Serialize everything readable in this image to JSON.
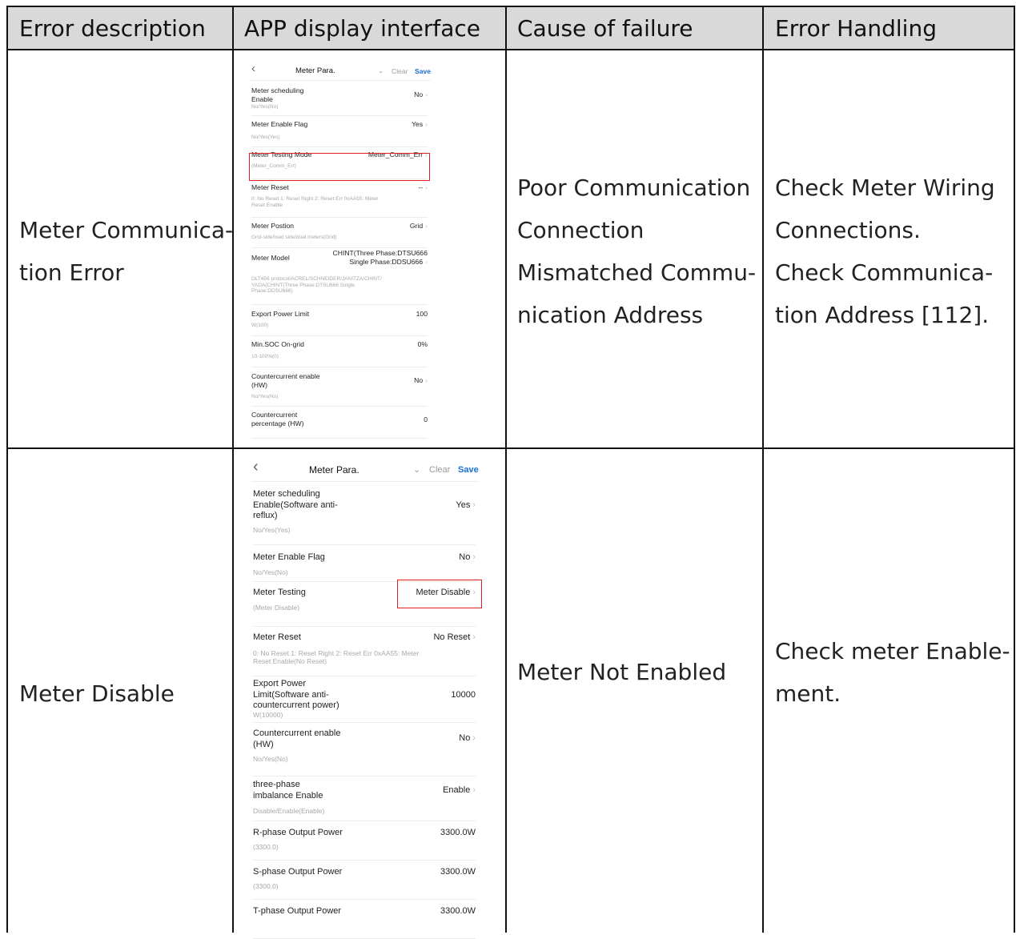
{
  "headers": [
    "Error description",
    "APP display interface",
    "Cause of failure",
    "Error Handling"
  ],
  "rows": [
    {
      "description": [
        "Meter Communica-",
        "tion Error"
      ],
      "cause": [
        "Poor Communication",
        "Connection",
        "Mismatched Commu-",
        "nication Address"
      ],
      "handling": [
        "Check Meter Wiring",
        "Connections.",
        "Check Communica-",
        "tion Address [112]."
      ]
    },
    {
      "description": [
        "Meter Disable"
      ],
      "cause": [
        "Meter Not Enabled"
      ],
      "handling": [
        "Check meter Enable-",
        "ment."
      ]
    }
  ],
  "app1": {
    "title": "Meter Para.",
    "clear": "Clear",
    "save": "Save",
    "items": [
      {
        "label": [
          "Meter scheduling",
          "Enable"
        ],
        "value": "No",
        "hint": [
          "No/Yes(No)"
        ]
      },
      {
        "label": [
          "Meter Enable Flag"
        ],
        "value": "Yes",
        "hint": [
          "No/Yes(Yes)"
        ]
      },
      {
        "label": [
          "Meter Testing Mode"
        ],
        "value": "Meter_Comm_Err",
        "hint": [
          "(Meter_Comm_Err)"
        ]
      },
      {
        "label": [
          "Meter Reset"
        ],
        "value": "--",
        "hint": [
          "0:  No Reset 1:  Reset Right  2:  Reset Err  0xAA55:  Meter",
          "Reset Enable"
        ]
      },
      {
        "label": [
          "Meter Postion"
        ],
        "value": "Grid",
        "hint": [
          "Grid-side/load side/dual meters(Grid)"
        ]
      },
      {
        "label": [
          "Meter Model"
        ],
        "value": "CHINT(Three Phase:DTSU666 Single Phase:DDSU666",
        "hint": [
          "DLT456 protocol/ACREL/SCHNEIDER/JANITZA/CHINT/",
          "YADA(CHINT(Three Phase:DTSU666 Single",
          "Phase:DDSU666)"
        ]
      },
      {
        "label": [
          "Export Power Limit"
        ],
        "value": "100",
        "hint": [
          "W(100)"
        ]
      },
      {
        "label": [
          "Min.SOC On-grid"
        ],
        "value": "0%",
        "hint": [
          "10-100%(0)"
        ]
      },
      {
        "label": [
          "Countercurrent enable",
          "(HW)"
        ],
        "value": "No",
        "hint": [
          "No/Yes(No)"
        ]
      },
      {
        "label": [
          "Countercurrent",
          "percentage (HW)"
        ],
        "value": "0",
        "hint": []
      }
    ]
  },
  "app2": {
    "title": "Meter Para.",
    "clear": "Clear",
    "save": "Save",
    "items": [
      {
        "label": [
          "Meter scheduling",
          "Enable(Software anti-",
          "reflux)"
        ],
        "value": "Yes",
        "hint": [
          "No/Yes(Yes)"
        ]
      },
      {
        "label": [
          "Meter Enable Flag"
        ],
        "value": "No",
        "hint": [
          "No/Yes(No)"
        ]
      },
      {
        "label": [
          "Meter Testing"
        ],
        "value": "Meter Disable",
        "hint": [
          "(Meter Disable)"
        ]
      },
      {
        "label": [
          "Meter Reset"
        ],
        "value": "No Reset",
        "hint": [
          "0:  No Reset 1:  Reset Right  2:  Reset Err  0xAA55:  Meter",
          "Reset Enable(No Reset)"
        ]
      },
      {
        "label": [
          "Export Power",
          "Limit(Software anti-",
          "countercurrent power)"
        ],
        "value": "10000",
        "hint": [
          "W(10000)"
        ]
      },
      {
        "label": [
          "Countercurrent enable",
          "(HW)"
        ],
        "value": "No",
        "hint": [
          "No/Yes(No)"
        ]
      },
      {
        "label": [
          "three-phase",
          "imbalance Enable"
        ],
        "value": "Enable",
        "hint": [
          "Disable/Enable(Enable)"
        ]
      },
      {
        "label": [
          "R-phase Output Power"
        ],
        "value": "3300.0W",
        "hint": [
          "(3300.0)"
        ]
      },
      {
        "label": [
          "S-phase Output Power"
        ],
        "value": "3300.0W",
        "hint": [
          "(3300.0)"
        ]
      },
      {
        "label": [
          "T-phase Output Power"
        ],
        "value": "3300.0W",
        "hint": []
      }
    ]
  }
}
